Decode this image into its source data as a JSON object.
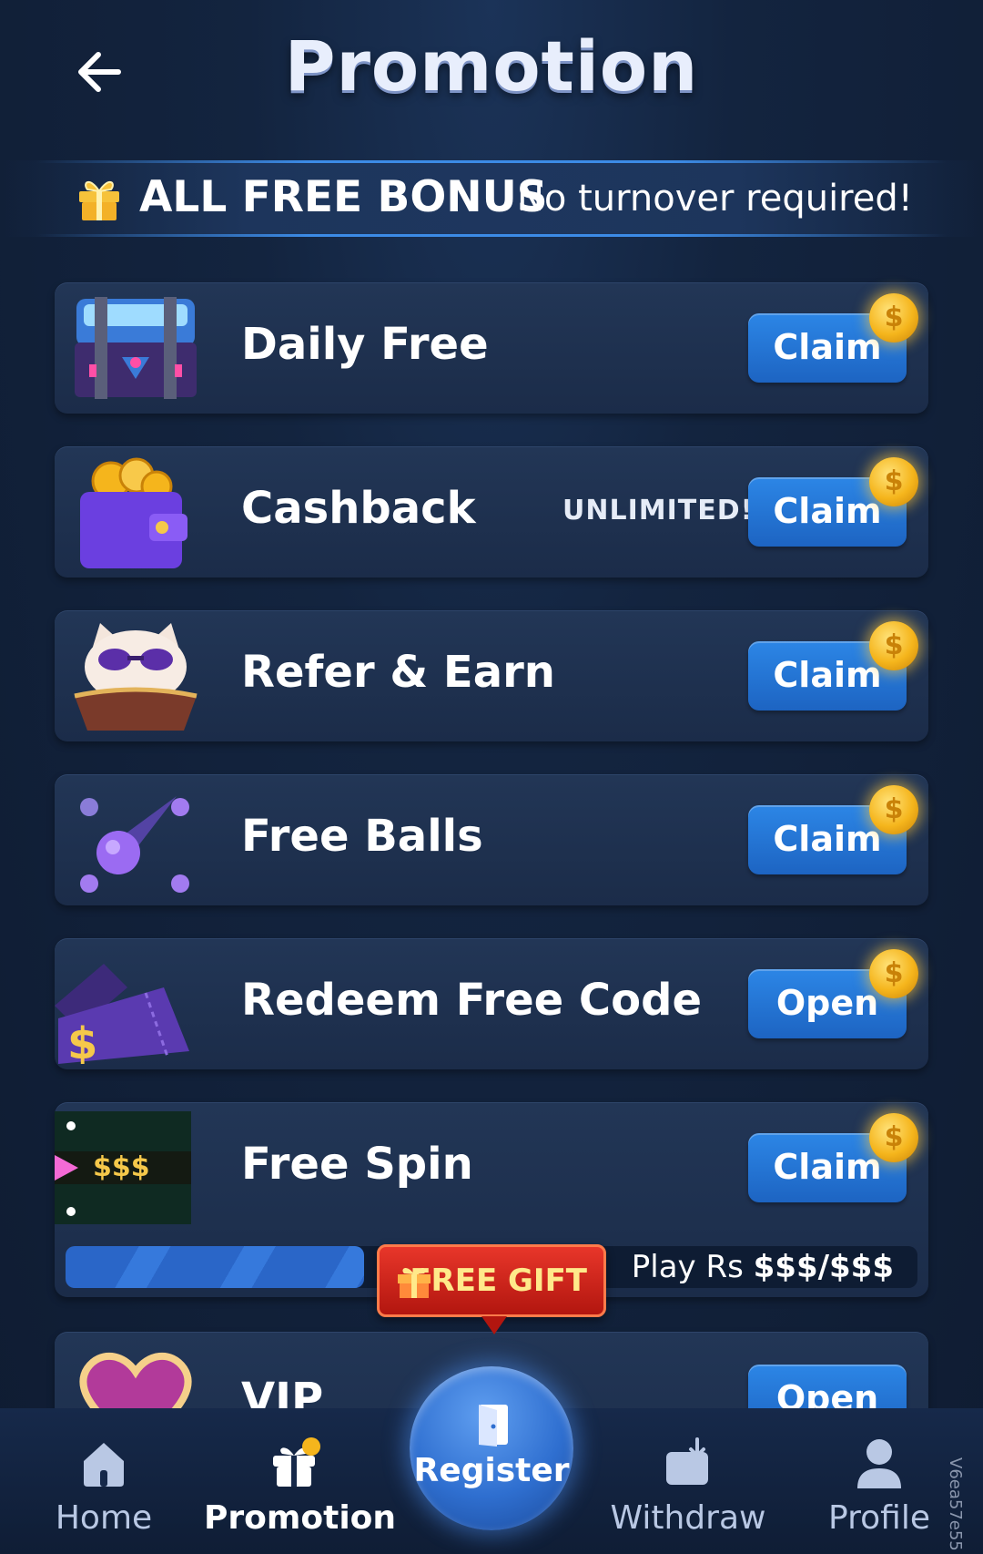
{
  "header": {
    "title": "Promotion"
  },
  "banner": {
    "title": "ALL FREE BONUS",
    "subtitle": "No turnover required!"
  },
  "cards": [
    {
      "title": "Daily Free",
      "button": "Claim",
      "coin": "$"
    },
    {
      "title": "Cashback",
      "tag": "UNLIMITED!",
      "button": "Claim",
      "coin": "$"
    },
    {
      "title": "Refer & Earn",
      "button": "Claim",
      "coin": "$"
    },
    {
      "title": "Free Balls",
      "button": "Claim",
      "coin": "$"
    },
    {
      "title": "Redeem Free Code",
      "button": "Open",
      "coin": "$"
    },
    {
      "title": "Free Spin",
      "button": "Claim",
      "coin": "$",
      "thumb_text": "$$$",
      "play_prefix": "Play Rs",
      "play_amount": "$$$/$$$",
      "progress": 0.35
    },
    {
      "title": "VIP",
      "button": "Open"
    }
  ],
  "free_gift": {
    "label": "FREE GIFT"
  },
  "nav": {
    "home": "Home",
    "promotion": "Promotion",
    "register": "Register",
    "withdraw": "Withdraw",
    "profile": "Profile"
  },
  "version": "V6ea57e55",
  "colors": {
    "accent": "#2c86e6",
    "coin": "#f5b51c",
    "gift": "#e8362a"
  }
}
